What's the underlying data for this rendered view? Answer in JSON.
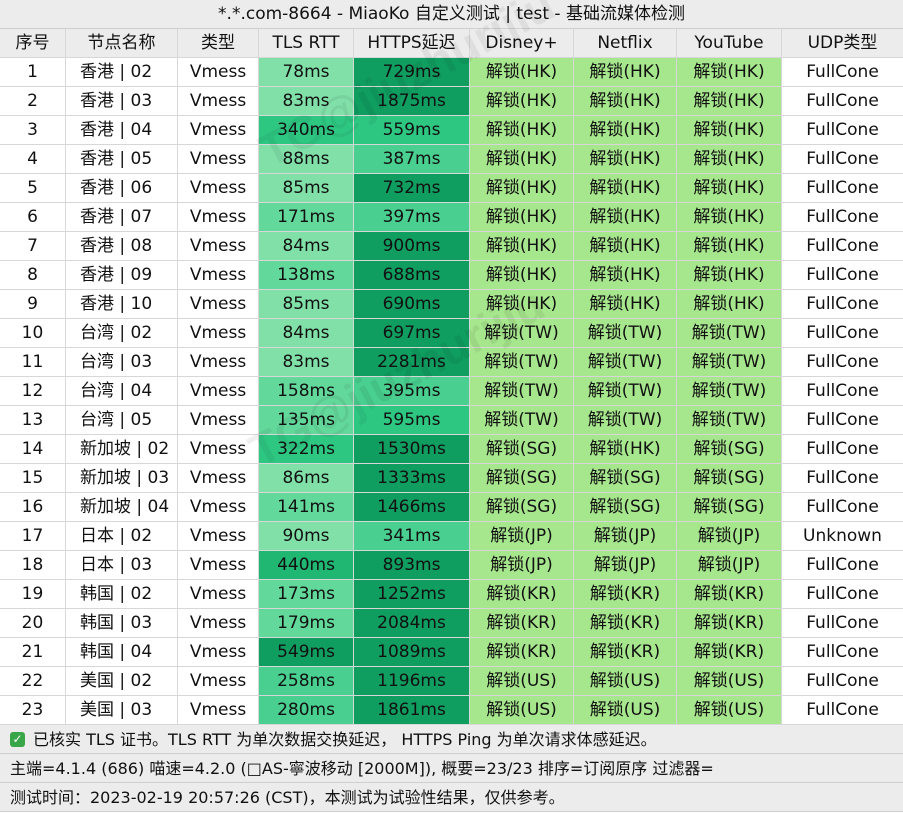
{
  "title": "*.*.com-8664 - MiaoKo 自定义测试 | test - 基础流媒体检测",
  "headers": [
    "序号",
    "节点名称",
    "类型",
    "TLS RTT",
    "HTTPS延迟",
    "Disney+",
    "Netflix",
    "YouTube",
    "UDP类型"
  ],
  "rows": [
    [
      "1",
      "香港 | 02",
      "Vmess",
      "78ms",
      "729ms",
      "解锁(HK)",
      "解锁(HK)",
      "解锁(HK)",
      "FullCone"
    ],
    [
      "2",
      "香港 | 03",
      "Vmess",
      "83ms",
      "1875ms",
      "解锁(HK)",
      "解锁(HK)",
      "解锁(HK)",
      "FullCone"
    ],
    [
      "3",
      "香港 | 04",
      "Vmess",
      "340ms",
      "559ms",
      "解锁(HK)",
      "解锁(HK)",
      "解锁(HK)",
      "FullCone"
    ],
    [
      "4",
      "香港 | 05",
      "Vmess",
      "88ms",
      "387ms",
      "解锁(HK)",
      "解锁(HK)",
      "解锁(HK)",
      "FullCone"
    ],
    [
      "5",
      "香港 | 06",
      "Vmess",
      "85ms",
      "732ms",
      "解锁(HK)",
      "解锁(HK)",
      "解锁(HK)",
      "FullCone"
    ],
    [
      "6",
      "香港 | 07",
      "Vmess",
      "171ms",
      "397ms",
      "解锁(HK)",
      "解锁(HK)",
      "解锁(HK)",
      "FullCone"
    ],
    [
      "7",
      "香港 | 08",
      "Vmess",
      "84ms",
      "900ms",
      "解锁(HK)",
      "解锁(HK)",
      "解锁(HK)",
      "FullCone"
    ],
    [
      "8",
      "香港 | 09",
      "Vmess",
      "138ms",
      "688ms",
      "解锁(HK)",
      "解锁(HK)",
      "解锁(HK)",
      "FullCone"
    ],
    [
      "9",
      "香港 | 10",
      "Vmess",
      "85ms",
      "690ms",
      "解锁(HK)",
      "解锁(HK)",
      "解锁(HK)",
      "FullCone"
    ],
    [
      "10",
      "台湾 | 02",
      "Vmess",
      "84ms",
      "697ms",
      "解锁(TW)",
      "解锁(TW)",
      "解锁(TW)",
      "FullCone"
    ],
    [
      "11",
      "台湾 | 03",
      "Vmess",
      "83ms",
      "2281ms",
      "解锁(TW)",
      "解锁(TW)",
      "解锁(TW)",
      "FullCone"
    ],
    [
      "12",
      "台湾 | 04",
      "Vmess",
      "158ms",
      "395ms",
      "解锁(TW)",
      "解锁(TW)",
      "解锁(TW)",
      "FullCone"
    ],
    [
      "13",
      "台湾 | 05",
      "Vmess",
      "135ms",
      "595ms",
      "解锁(TW)",
      "解锁(TW)",
      "解锁(TW)",
      "FullCone"
    ],
    [
      "14",
      "新加坡 | 02",
      "Vmess",
      "322ms",
      "1530ms",
      "解锁(SG)",
      "解锁(HK)",
      "解锁(SG)",
      "FullCone"
    ],
    [
      "15",
      "新加坡 | 03",
      "Vmess",
      "86ms",
      "1333ms",
      "解锁(SG)",
      "解锁(SG)",
      "解锁(SG)",
      "FullCone"
    ],
    [
      "16",
      "新加坡 | 04",
      "Vmess",
      "141ms",
      "1466ms",
      "解锁(SG)",
      "解锁(SG)",
      "解锁(SG)",
      "FullCone"
    ],
    [
      "17",
      "日本 | 02",
      "Vmess",
      "90ms",
      "341ms",
      "解锁(JP)",
      "解锁(JP)",
      "解锁(JP)",
      "Unknown"
    ],
    [
      "18",
      "日本 | 03",
      "Vmess",
      "440ms",
      "893ms",
      "解锁(JP)",
      "解锁(JP)",
      "解锁(JP)",
      "FullCone"
    ],
    [
      "19",
      "韩国 | 02",
      "Vmess",
      "173ms",
      "1252ms",
      "解锁(KR)",
      "解锁(KR)",
      "解锁(KR)",
      "FullCone"
    ],
    [
      "20",
      "韩国 | 03",
      "Vmess",
      "179ms",
      "2084ms",
      "解锁(KR)",
      "解锁(KR)",
      "解锁(KR)",
      "FullCone"
    ],
    [
      "21",
      "韩国 | 04",
      "Vmess",
      "549ms",
      "1089ms",
      "解锁(KR)",
      "解锁(KR)",
      "解锁(KR)",
      "FullCone"
    ],
    [
      "22",
      "美国 | 02",
      "Vmess",
      "258ms",
      "1196ms",
      "解锁(US)",
      "解锁(US)",
      "解锁(US)",
      "FullCone"
    ],
    [
      "23",
      "美国 | 03",
      "Vmess",
      "280ms",
      "1861ms",
      "解锁(US)",
      "解锁(US)",
      "解锁(US)",
      "FullCone"
    ]
  ],
  "rtt_colors": [
    "#80e0a8",
    "#80e0a8",
    "#2ec782",
    "#80e0a8",
    "#80e0a8",
    "#63d89b",
    "#80e0a8",
    "#63d89b",
    "#80e0a8",
    "#80e0a8",
    "#80e0a8",
    "#63d89b",
    "#63d89b",
    "#2ec782",
    "#80e0a8",
    "#63d89b",
    "#80e0a8",
    "#1fb772",
    "#63d89b",
    "#63d89b",
    "#0f9d60",
    "#49cf8f",
    "#49cf8f"
  ],
  "https_colors": [
    "#0f9d60",
    "#0f9d60",
    "#2ec782",
    "#49cf8f",
    "#0f9d60",
    "#49cf8f",
    "#0f9d60",
    "#0f9d60",
    "#0f9d60",
    "#0f9d60",
    "#0f9d60",
    "#49cf8f",
    "#2ec782",
    "#0f9d60",
    "#0f9d60",
    "#0f9d60",
    "#49cf8f",
    "#0f9d60",
    "#0f9d60",
    "#0f9d60",
    "#0f9d60",
    "#0f9d60",
    "#0f9d60"
  ],
  "unlock_color": "#a6e68c",
  "footer": {
    "line1": "已核实 TLS 证书。TLS RTT 为单次数据交换延迟， HTTPS Ping 为单次请求体感延迟。",
    "line2": "主端=4.1.4 (686) 喵速=4.2.0 (□AS-寧波移动 [2000M]), 概要=23/23 排序=订阅原序 过滤器=",
    "line3": "测试时间：2023-02-19 20:57:26 (CST)，本测试为试验性结果，仅供参考。"
  },
  "watermark_text": "TG@jiuzhurijiu"
}
